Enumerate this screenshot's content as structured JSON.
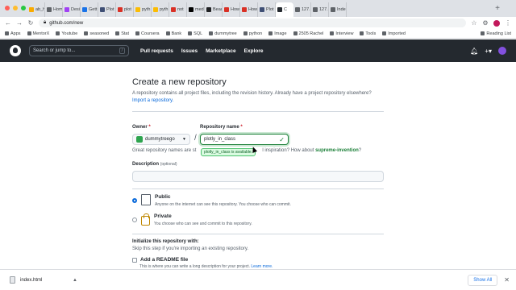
{
  "browser": {
    "tabs": [
      {
        "label": "ab_h",
        "color": "#f9ab00"
      },
      {
        "label": "Hom",
        "color": "#5f6368"
      },
      {
        "label": "Desi",
        "color": "#a142f4"
      },
      {
        "label": "Gett",
        "color": "#1a73e8"
      },
      {
        "label": "Plot",
        "color": "#3f4f75"
      },
      {
        "label": "plot",
        "color": "#d93025"
      },
      {
        "label": "pyth",
        "color": "#fbbc04"
      },
      {
        "label": "pyth",
        "color": "#fbbc04"
      },
      {
        "label": "not",
        "color": "#d93025"
      },
      {
        "label": "med",
        "color": "#000000"
      },
      {
        "label": "Beau",
        "color": "#202124"
      },
      {
        "label": "How",
        "color": "#d93025"
      },
      {
        "label": "How",
        "color": "#d93025"
      },
      {
        "label": "Plot",
        "color": "#3f4f75"
      },
      {
        "label": "C",
        "color": "#24292f"
      },
      {
        "label": "127.",
        "color": "#5f6368"
      },
      {
        "label": "127.",
        "color": "#5f6368"
      },
      {
        "label": "Inde",
        "color": "#5f6368"
      }
    ],
    "url": "github.com/new",
    "bookmarks": [
      "Apps",
      "MentorX",
      "Youtube",
      "seasoned",
      "Stat",
      "Coursera",
      "Bank",
      "SQL",
      "dummytree",
      "python",
      "Image",
      "2505 Rachel",
      "Interview",
      "Tools",
      "Imported"
    ],
    "reading_list": "Reading List"
  },
  "github": {
    "search_placeholder": "Search or jump to...",
    "search_key": "/",
    "nav": [
      "Pull requests",
      "Issues",
      "Marketplace",
      "Explore"
    ]
  },
  "form": {
    "title": "Create a new repository",
    "subtitle": "A repository contains all project files, including the revision history. Already have a project repository elsewhere?",
    "import_link": "Import a repository.",
    "owner_label": "Owner",
    "owner_value": "dummytreego",
    "repo_label": "Repository name",
    "repo_value": "plotly_in_class",
    "availability_tooltip": "plotly_in_class is available.",
    "hint_prefix": "Great repository names are st",
    "hint_middle": "l inspiration? How about ",
    "hint_suggestion": "supreme-invention",
    "hint_suffix": "?",
    "description_label": "Description",
    "description_optional": "(optional)",
    "public_label": "Public",
    "public_desc": "Anyone on the internet can see this repository. You choose who can commit.",
    "private_label": "Private",
    "private_desc": "You choose who can see and commit to this repository.",
    "init_title": "Initialize this repository with:",
    "init_sub": "Skip this step if you're importing an existing repository.",
    "readme_label": "Add a README file",
    "readme_desc": "This is where you can write a long description for your project.",
    "readme_link": "Learn more."
  },
  "downloads": {
    "file": "index.html",
    "show_all": "Show All"
  }
}
